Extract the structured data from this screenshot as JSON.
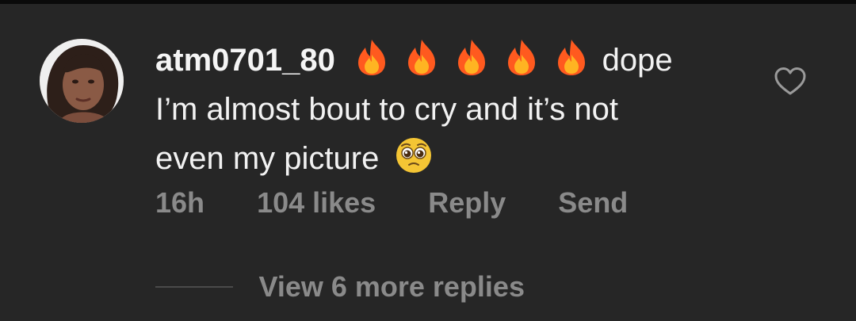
{
  "comment": {
    "username": "atm0701_80",
    "emoji_sequence": [
      "fire",
      "fire",
      "fire",
      "fire",
      "fire"
    ],
    "first_line_text": "dope",
    "second_line_text": "I’m almost bout to cry and it’s  not",
    "third_line_text": "even my picture",
    "third_line_emoji": "pleading-face",
    "time": "16h",
    "likes": "104 likes",
    "reply_label": "Reply",
    "send_label": "Send",
    "view_more": "View 6 more replies"
  },
  "colors": {
    "background": "#262626",
    "text_primary": "#f2f2f2",
    "text_secondary": "#8a8a8a"
  },
  "icons": {
    "like": "heart-icon",
    "avatar": "user-avatar"
  }
}
